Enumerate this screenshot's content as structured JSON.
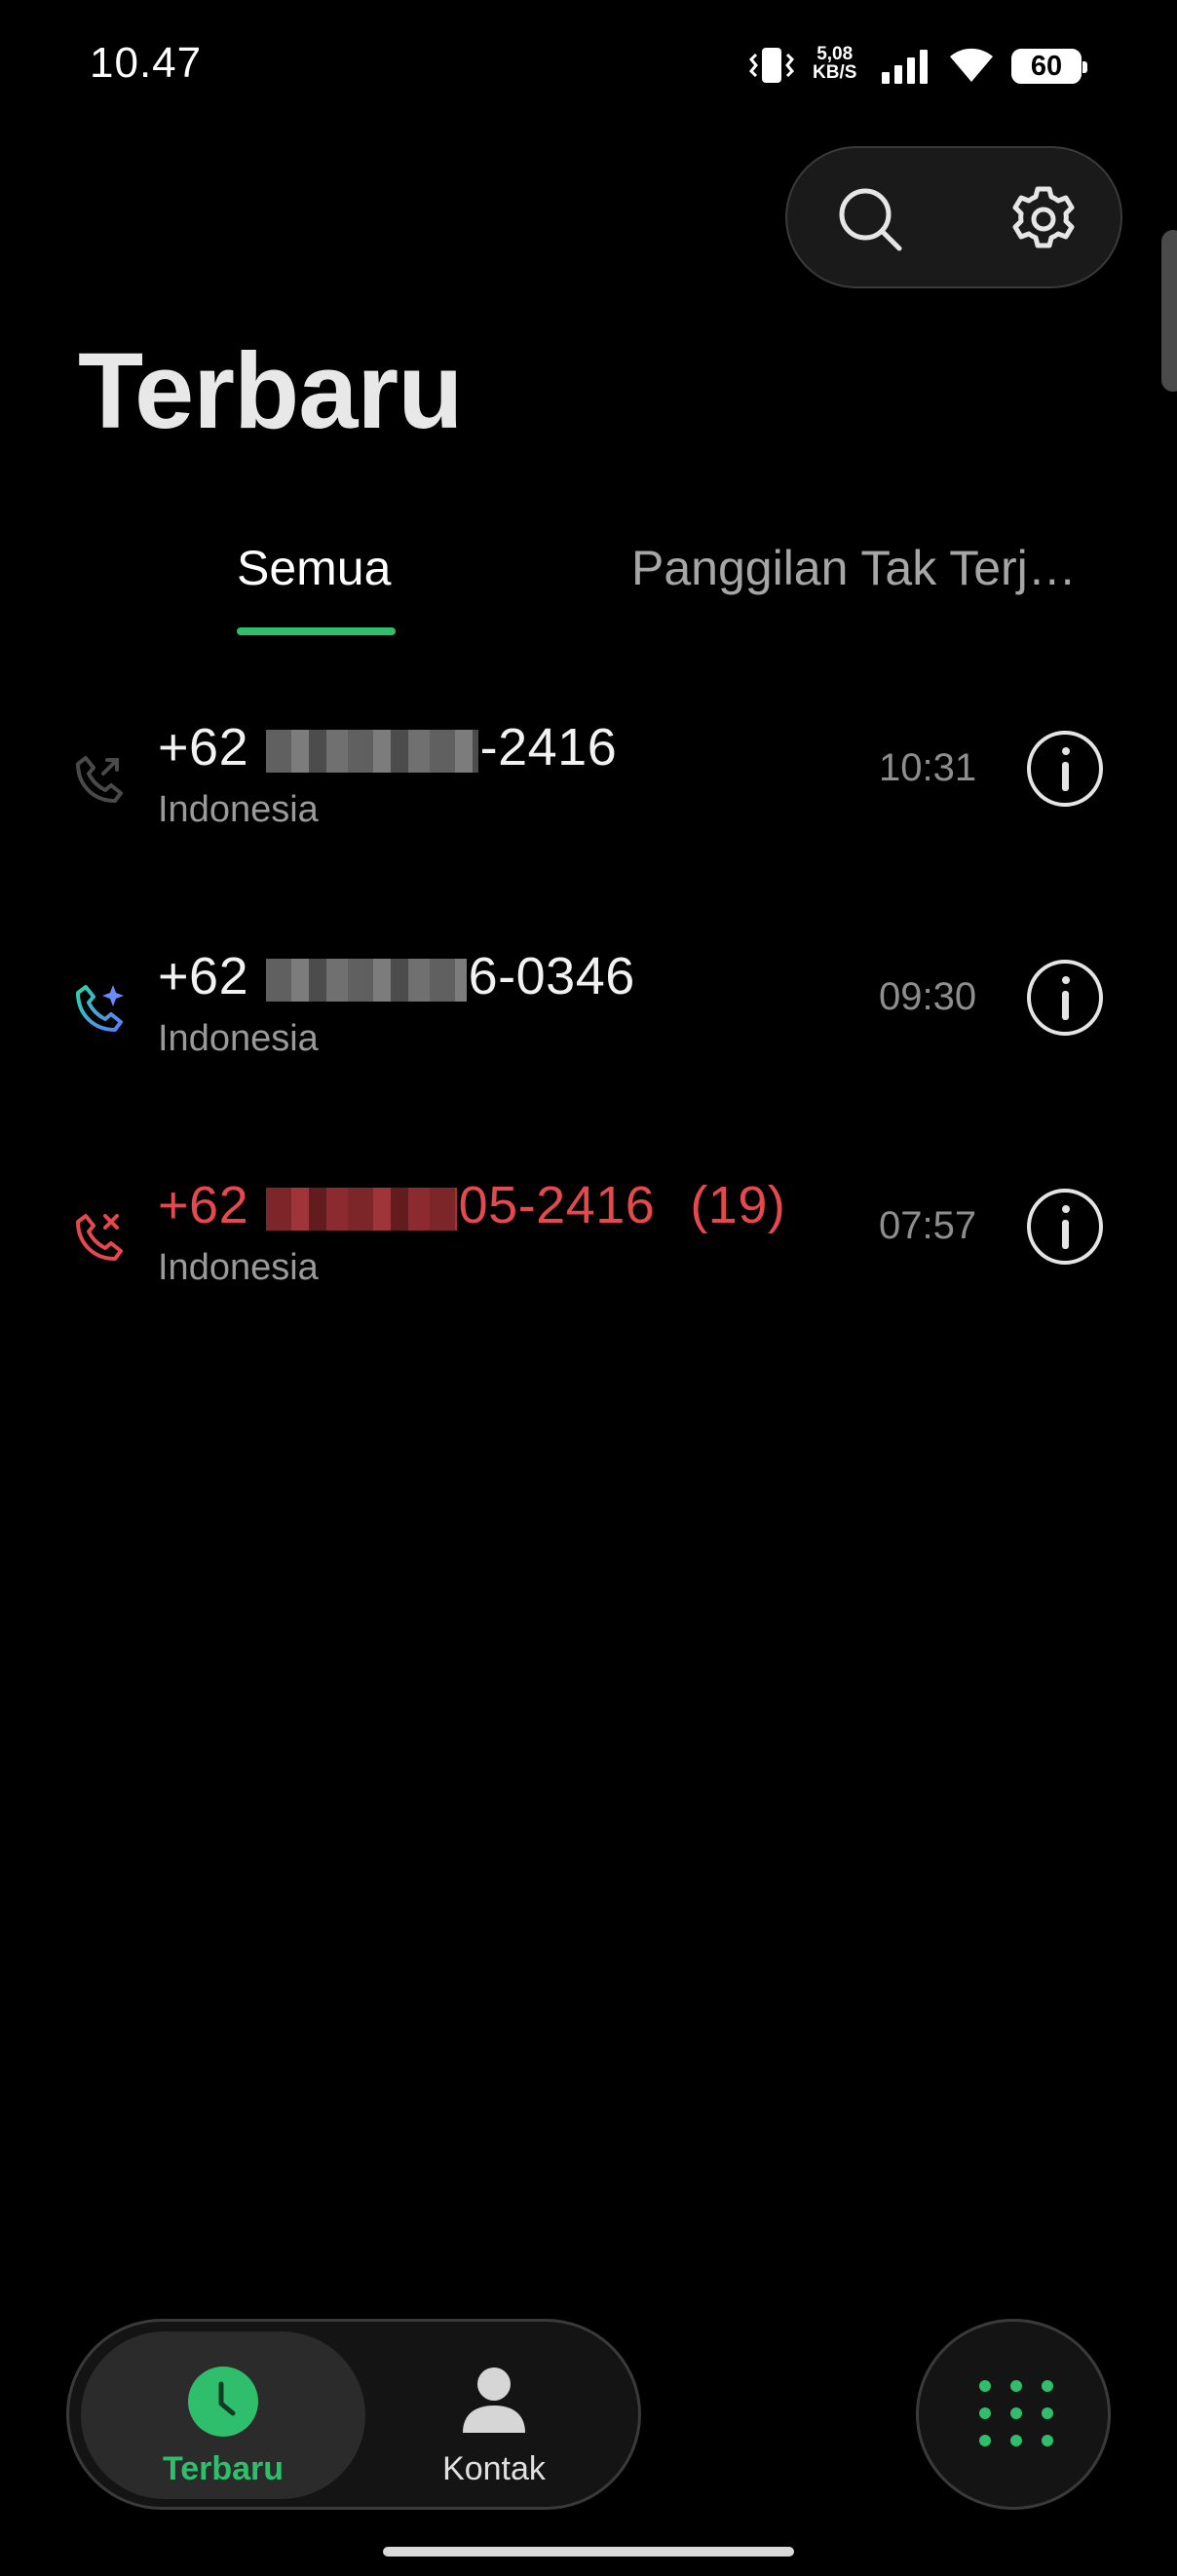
{
  "status_bar": {
    "time": "10.47",
    "net_speed_value": "5,08",
    "net_speed_unit": "KB/S",
    "battery": "60",
    "icons": [
      "vibrate-icon",
      "signal-icon",
      "wifi-icon",
      "battery-icon"
    ]
  },
  "header": {
    "title": "Terbaru",
    "actions": [
      "search-icon",
      "settings-icon"
    ]
  },
  "tabs": [
    {
      "label": "Semua",
      "active": true
    },
    {
      "label": "Panggilan Tak Terj…",
      "active": false
    }
  ],
  "calls": [
    {
      "prefix": "+62",
      "suffix": "-2416",
      "count": "",
      "location": "Indonesia",
      "time": "10:31",
      "type": "outgoing",
      "icon": "outgoing-call-icon"
    },
    {
      "prefix": "+62",
      "suffix": "6-0346",
      "count": "",
      "location": "Indonesia",
      "time": "09:30",
      "type": "incoming",
      "icon": "incoming-call-icon"
    },
    {
      "prefix": "+62",
      "suffix": "05-2416",
      "count": "(19)",
      "location": "Indonesia",
      "time": "07:57",
      "type": "missed",
      "icon": "missed-call-icon"
    }
  ],
  "bottom_nav": {
    "items": [
      {
        "label": "Terbaru",
        "icon": "clock-icon",
        "active": true
      },
      {
        "label": "Kontak",
        "icon": "person-icon",
        "active": false
      }
    ],
    "dialpad_icon": "dialpad-icon"
  },
  "colors": {
    "accent": "#2fbe6c",
    "missed": "#e5484d",
    "background": "#000000"
  }
}
